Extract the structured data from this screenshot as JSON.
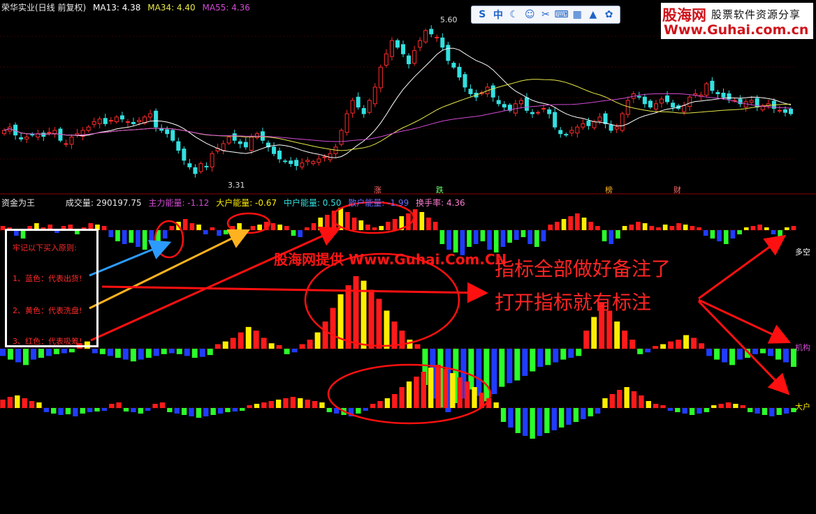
{
  "price_header": {
    "title": "荣华实业(日线 前复权)",
    "ma13": "MA13: 4.38",
    "ma34": "MA34: 4.40",
    "ma55": "MA55: 4.36",
    "high_label": "5.60",
    "low_label": "3.31"
  },
  "event_markers": [
    "涨",
    "跌",
    "榜",
    "财"
  ],
  "indicator_header": {
    "name": "资金为王",
    "volume": "成交量: 290197.75",
    "main_force": "主力能量: -1.12",
    "big_holder": "大户能量: -0.67",
    "mid_holder": "中户能量: 0.50",
    "retail": "散户能量: -1.99",
    "turnover": "换手率: 4.36"
  },
  "watermark": {
    "brand": "股海网",
    "slogan": "股票软件资源分享",
    "url": "Www.Guhai.com.cn"
  },
  "toolbar_icons": [
    "s-icon",
    "zhong-icon",
    "moon-icon",
    "smile-icon",
    "mic-icon",
    "keyboard-icon",
    "grid-icon",
    "shirt-icon",
    "gear-icon"
  ],
  "toolbar_glyphs": [
    "S",
    "中",
    "☾",
    "☺",
    "✂",
    "⌨",
    "▦",
    "▲",
    "✿"
  ],
  "legend": {
    "title": "牢记以下买入原则:",
    "blue": "1、蓝色：代表出货!",
    "yellow": "2、黄色：代表洗盘!",
    "red": "3、红色：代表吸筹!"
  },
  "annotations": {
    "provider": "股海网提供 Www.Guhai.Com.CN",
    "note1": "指标全部做好备注了",
    "note2": "打开指标就有标注"
  },
  "row_labels": {
    "duokong": "多空",
    "jigou": "机构",
    "dahu": "大户"
  },
  "colors": {
    "up": "#ff2b2b",
    "down": "#33e0e0",
    "ma13": "#ffffff",
    "ma34": "#e8e84a",
    "ma55": "#d34ad3",
    "red": "#ff1a1a",
    "yellow": "#ffee00",
    "blue": "#1f3cff",
    "green": "#2bff2b",
    "arrow_red": "#ff1010",
    "arrow_blue": "#2c9bff",
    "arrow_orange": "#ffb21f"
  },
  "chart_data": [
    {
      "type": "candlestick",
      "title": "荣华实业(日线 前复权)",
      "ylim": [
        3.2,
        5.8
      ],
      "series": [
        {
          "name": "MA13",
          "value": 4.38
        },
        {
          "name": "MA34",
          "value": 4.4
        },
        {
          "name": "MA55",
          "value": 4.36
        }
      ],
      "annotations": [
        {
          "label": "5.60",
          "type": "high"
        },
        {
          "label": "3.31",
          "type": "low"
        }
      ],
      "close": [
        4.05,
        4.1,
        3.98,
        3.92,
        3.95,
        3.98,
        4.0,
        3.96,
        4.02,
        4.05,
        3.9,
        3.85,
        3.95,
        4.0,
        4.05,
        4.1,
        4.18,
        4.22,
        4.15,
        4.2,
        4.25,
        4.22,
        4.18,
        4.15,
        4.2,
        4.25,
        4.3,
        4.1,
        4.05,
        4.0,
        3.9,
        3.75,
        3.6,
        3.5,
        3.4,
        3.55,
        3.5,
        3.7,
        3.78,
        3.85,
        3.95,
        3.9,
        3.85,
        3.8,
        3.95,
        4.0,
        3.9,
        3.8,
        3.7,
        3.62,
        3.58,
        3.55,
        3.52,
        3.56,
        3.6,
        3.58,
        3.62,
        3.65,
        3.7,
        3.8,
        4.05,
        4.3,
        4.5,
        4.4,
        4.3,
        4.5,
        4.7,
        5.0,
        5.2,
        5.4,
        5.3,
        5.2,
        5.05,
        5.25,
        5.4,
        5.55,
        5.5,
        5.45,
        5.3,
        5.1,
        5.0,
        4.85,
        4.7,
        4.6,
        4.55,
        4.62,
        4.7,
        4.55,
        4.45,
        4.4,
        4.35,
        4.45,
        4.5,
        4.35,
        4.3,
        4.32,
        4.38,
        4.3,
        4.1,
        4.0,
        3.98,
        4.05,
        4.1,
        4.15,
        4.12,
        4.18,
        4.25,
        4.15,
        4.05,
        4.1,
        4.3,
        4.5,
        4.6,
        4.55,
        4.45,
        4.4,
        4.45,
        4.52,
        4.48,
        4.4,
        4.38,
        4.42,
        4.55,
        4.6,
        4.58,
        4.75,
        4.65,
        4.6,
        4.55,
        4.52,
        4.5,
        4.45,
        4.48,
        4.5,
        4.4,
        4.42,
        4.45,
        4.38,
        4.35,
        4.32,
        4.3
      ],
      "volume": 290197.75
    },
    {
      "type": "bar",
      "title": "资金为王",
      "series": [
        {
          "name": "多空",
          "values": [
            3,
            2,
            -4,
            -6,
            3,
            5,
            2,
            4,
            -2,
            3,
            4,
            -3,
            2,
            5,
            4,
            3,
            -5,
            -8,
            -10,
            -9,
            -12,
            -14,
            -10,
            -8,
            -6,
            3,
            6,
            8,
            5,
            4,
            -3,
            2,
            -4,
            -3,
            3,
            5,
            -2,
            3,
            4,
            6,
            5,
            4,
            3,
            -4,
            -5,
            2,
            5,
            9,
            11,
            14,
            16,
            13,
            9,
            7,
            4,
            2,
            3,
            6,
            8,
            10,
            12,
            15,
            13,
            9,
            6,
            -10,
            -14,
            -16,
            -18,
            -12,
            -10,
            -8,
            -14,
            -16,
            -12,
            -9,
            -7,
            -5,
            -10,
            -12,
            -8,
            4,
            6,
            8,
            10,
            12,
            9,
            6,
            3,
            -8,
            -10,
            -6,
            3,
            4,
            6,
            5,
            3,
            2,
            4,
            3,
            5,
            4,
            3,
            2,
            -4,
            -6,
            -8,
            -10,
            -6,
            -3,
            2,
            3,
            4,
            2,
            -3,
            -5,
            2,
            3
          ]
        },
        {
          "name": "机构",
          "values": [
            -8,
            -12,
            -15,
            -18,
            -12,
            -10,
            -8,
            -6,
            -5,
            -4,
            6,
            8,
            -5,
            -6,
            -8,
            -10,
            -12,
            -14,
            -12,
            -10,
            -8,
            -6,
            -5,
            -6,
            -8,
            -10,
            -9,
            -7,
            5,
            8,
            12,
            18,
            24,
            20,
            12,
            6,
            4,
            -6,
            -4,
            5,
            10,
            18,
            30,
            45,
            60,
            70,
            80,
            75,
            65,
            55,
            42,
            30,
            20,
            10,
            5,
            -40,
            -55,
            -65,
            -70,
            -60,
            -55,
            -45,
            -52,
            -58,
            -50,
            -42,
            -38,
            -35,
            -30,
            -25,
            -20,
            -18,
            -15,
            -12,
            -10,
            -8,
            20,
            35,
            50,
            42,
            30,
            20,
            10,
            -6,
            -4,
            3,
            5,
            8,
            10,
            15,
            12,
            6,
            -8,
            -12,
            -15,
            -18,
            -12,
            -10,
            -6,
            -5,
            -8,
            -12,
            -15,
            -20
          ]
        },
        {
          "name": "大户",
          "values": [
            12,
            16,
            18,
            14,
            10,
            8,
            -6,
            -8,
            -10,
            -9,
            -12,
            -8,
            -6,
            -5,
            -4,
            6,
            8,
            -5,
            -6,
            -8,
            -4,
            6,
            8,
            -6,
            -8,
            -10,
            -12,
            -14,
            -12,
            -10,
            -8,
            -6,
            -5,
            -4,
            4,
            6,
            8,
            10,
            12,
            14,
            16,
            14,
            12,
            10,
            8,
            -6,
            -8,
            -10,
            -12,
            -8,
            -4,
            6,
            10,
            14,
            20,
            30,
            38,
            45,
            52,
            58,
            62,
            56,
            50,
            44,
            38,
            30,
            22,
            14,
            8,
            -20,
            -28,
            -36,
            -40,
            -44,
            -40,
            -36,
            -32,
            -28,
            -24,
            -20,
            -16,
            -12,
            -8,
            14,
            20,
            26,
            30,
            24,
            18,
            10,
            6,
            4,
            -4,
            -6,
            -8,
            -10,
            -8,
            -6,
            4,
            6,
            8,
            6,
            4,
            -6,
            -8,
            -10,
            -12,
            -10,
            -8,
            -6
          ]
        }
      ]
    }
  ]
}
